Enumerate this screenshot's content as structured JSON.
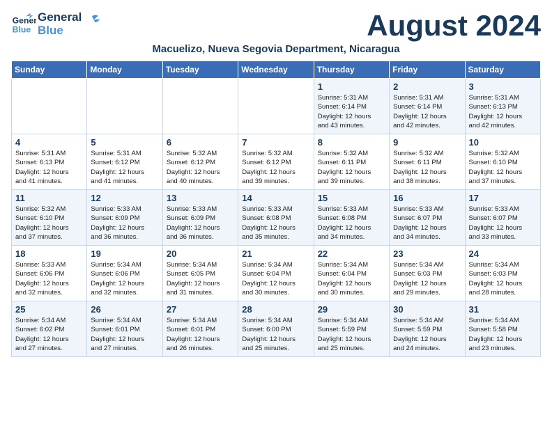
{
  "header": {
    "logo_general": "General",
    "logo_blue": "Blue",
    "month_title": "August 2024",
    "subtitle": "Macuelizo, Nueva Segovia Department, Nicaragua"
  },
  "weekdays": [
    "Sunday",
    "Monday",
    "Tuesday",
    "Wednesday",
    "Thursday",
    "Friday",
    "Saturday"
  ],
  "weeks": [
    [
      {
        "day": "",
        "info": ""
      },
      {
        "day": "",
        "info": ""
      },
      {
        "day": "",
        "info": ""
      },
      {
        "day": "",
        "info": ""
      },
      {
        "day": "1",
        "info": "Sunrise: 5:31 AM\nSunset: 6:14 PM\nDaylight: 12 hours\nand 43 minutes."
      },
      {
        "day": "2",
        "info": "Sunrise: 5:31 AM\nSunset: 6:14 PM\nDaylight: 12 hours\nand 42 minutes."
      },
      {
        "day": "3",
        "info": "Sunrise: 5:31 AM\nSunset: 6:13 PM\nDaylight: 12 hours\nand 42 minutes."
      }
    ],
    [
      {
        "day": "4",
        "info": "Sunrise: 5:31 AM\nSunset: 6:13 PM\nDaylight: 12 hours\nand 41 minutes."
      },
      {
        "day": "5",
        "info": "Sunrise: 5:31 AM\nSunset: 6:12 PM\nDaylight: 12 hours\nand 41 minutes."
      },
      {
        "day": "6",
        "info": "Sunrise: 5:32 AM\nSunset: 6:12 PM\nDaylight: 12 hours\nand 40 minutes."
      },
      {
        "day": "7",
        "info": "Sunrise: 5:32 AM\nSunset: 6:12 PM\nDaylight: 12 hours\nand 39 minutes."
      },
      {
        "day": "8",
        "info": "Sunrise: 5:32 AM\nSunset: 6:11 PM\nDaylight: 12 hours\nand 39 minutes."
      },
      {
        "day": "9",
        "info": "Sunrise: 5:32 AM\nSunset: 6:11 PM\nDaylight: 12 hours\nand 38 minutes."
      },
      {
        "day": "10",
        "info": "Sunrise: 5:32 AM\nSunset: 6:10 PM\nDaylight: 12 hours\nand 37 minutes."
      }
    ],
    [
      {
        "day": "11",
        "info": "Sunrise: 5:32 AM\nSunset: 6:10 PM\nDaylight: 12 hours\nand 37 minutes."
      },
      {
        "day": "12",
        "info": "Sunrise: 5:33 AM\nSunset: 6:09 PM\nDaylight: 12 hours\nand 36 minutes."
      },
      {
        "day": "13",
        "info": "Sunrise: 5:33 AM\nSunset: 6:09 PM\nDaylight: 12 hours\nand 36 minutes."
      },
      {
        "day": "14",
        "info": "Sunrise: 5:33 AM\nSunset: 6:08 PM\nDaylight: 12 hours\nand 35 minutes."
      },
      {
        "day": "15",
        "info": "Sunrise: 5:33 AM\nSunset: 6:08 PM\nDaylight: 12 hours\nand 34 minutes."
      },
      {
        "day": "16",
        "info": "Sunrise: 5:33 AM\nSunset: 6:07 PM\nDaylight: 12 hours\nand 34 minutes."
      },
      {
        "day": "17",
        "info": "Sunrise: 5:33 AM\nSunset: 6:07 PM\nDaylight: 12 hours\nand 33 minutes."
      }
    ],
    [
      {
        "day": "18",
        "info": "Sunrise: 5:33 AM\nSunset: 6:06 PM\nDaylight: 12 hours\nand 32 minutes."
      },
      {
        "day": "19",
        "info": "Sunrise: 5:34 AM\nSunset: 6:06 PM\nDaylight: 12 hours\nand 32 minutes."
      },
      {
        "day": "20",
        "info": "Sunrise: 5:34 AM\nSunset: 6:05 PM\nDaylight: 12 hours\nand 31 minutes."
      },
      {
        "day": "21",
        "info": "Sunrise: 5:34 AM\nSunset: 6:04 PM\nDaylight: 12 hours\nand 30 minutes."
      },
      {
        "day": "22",
        "info": "Sunrise: 5:34 AM\nSunset: 6:04 PM\nDaylight: 12 hours\nand 30 minutes."
      },
      {
        "day": "23",
        "info": "Sunrise: 5:34 AM\nSunset: 6:03 PM\nDaylight: 12 hours\nand 29 minutes."
      },
      {
        "day": "24",
        "info": "Sunrise: 5:34 AM\nSunset: 6:03 PM\nDaylight: 12 hours\nand 28 minutes."
      }
    ],
    [
      {
        "day": "25",
        "info": "Sunrise: 5:34 AM\nSunset: 6:02 PM\nDaylight: 12 hours\nand 27 minutes."
      },
      {
        "day": "26",
        "info": "Sunrise: 5:34 AM\nSunset: 6:01 PM\nDaylight: 12 hours\nand 27 minutes."
      },
      {
        "day": "27",
        "info": "Sunrise: 5:34 AM\nSunset: 6:01 PM\nDaylight: 12 hours\nand 26 minutes."
      },
      {
        "day": "28",
        "info": "Sunrise: 5:34 AM\nSunset: 6:00 PM\nDaylight: 12 hours\nand 25 minutes."
      },
      {
        "day": "29",
        "info": "Sunrise: 5:34 AM\nSunset: 5:59 PM\nDaylight: 12 hours\nand 25 minutes."
      },
      {
        "day": "30",
        "info": "Sunrise: 5:34 AM\nSunset: 5:59 PM\nDaylight: 12 hours\nand 24 minutes."
      },
      {
        "day": "31",
        "info": "Sunrise: 5:34 AM\nSunset: 5:58 PM\nDaylight: 12 hours\nand 23 minutes."
      }
    ]
  ]
}
